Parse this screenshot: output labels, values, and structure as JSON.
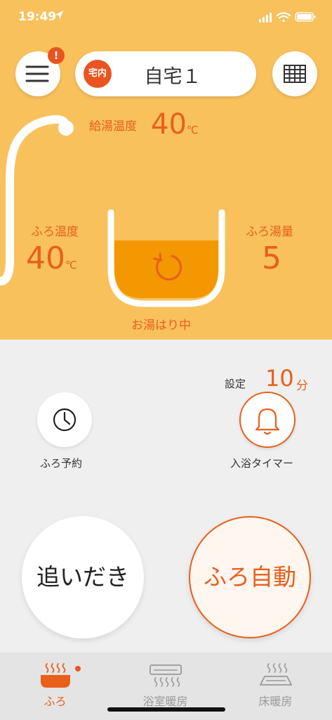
{
  "status_bar": {
    "time": "19:49"
  },
  "header": {
    "home_tag": "宅内",
    "home_name": "自宅１",
    "menu_badge": "!"
  },
  "hot_water": {
    "label": "給湯温度",
    "value": "40",
    "unit": "℃"
  },
  "bath_temp": {
    "label": "ふろ温度",
    "value": "40",
    "unit": "℃"
  },
  "bath_volume": {
    "label": "ふろ湯量",
    "value": "5"
  },
  "bath_status": "お湯はり中",
  "timer_setting": {
    "label": "設定",
    "value": "10",
    "unit": "分"
  },
  "actions": {
    "reserve_label": "ふろ予約",
    "timer_label": "入浴タイマー",
    "oidaki_label": "追いだき",
    "auto_label": "ふろ自動"
  },
  "tabs": [
    {
      "label": "ふろ",
      "active": true
    },
    {
      "label": "浴室暖房",
      "active": false
    },
    {
      "label": "床暖房",
      "active": false
    }
  ],
  "colors": {
    "background_top": "#f8c15c",
    "accent": "#e8601c",
    "water": "#f39800",
    "badge": "#e95420",
    "panel": "#efefef"
  },
  "icons": {
    "menu": "hamburger-icon",
    "grid": "grid-icon",
    "refresh": "refresh-icon",
    "clock": "clock-icon",
    "bell": "bell-icon",
    "bath": "bath-icon",
    "bath_heater": "bathroom-heater-icon",
    "floor_heater": "floor-heater-icon"
  }
}
